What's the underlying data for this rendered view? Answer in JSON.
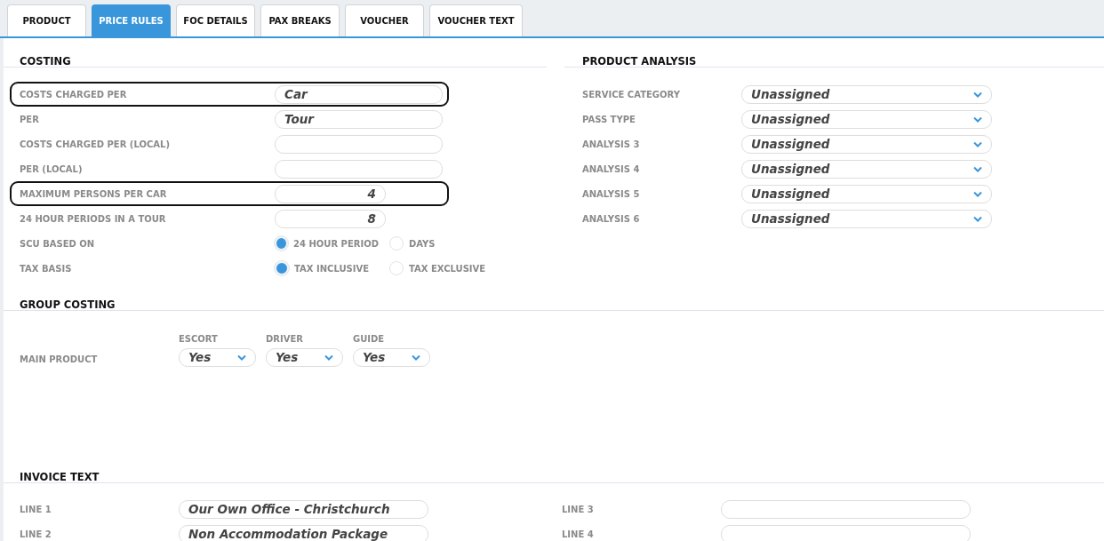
{
  "tabs": [
    {
      "label": "PRODUCT",
      "selected": false
    },
    {
      "label": "PRICE RULES",
      "selected": true
    },
    {
      "label": "FOC DETAILS",
      "selected": false
    },
    {
      "label": "PAX BREAKS",
      "selected": false
    },
    {
      "label": "VOUCHER",
      "selected": false
    },
    {
      "label": "VOUCHER TEXT",
      "selected": false
    }
  ],
  "costing": {
    "title": "COSTING",
    "rows": [
      {
        "label": "COSTS CHARGED PER",
        "kind": "text",
        "highlighted": true,
        "value": "Car"
      },
      {
        "label": "PER",
        "kind": "text",
        "highlighted": false,
        "value": "Tour"
      },
      {
        "label": "COSTS CHARGED PER (LOCAL)",
        "kind": "text",
        "highlighted": false
      },
      {
        "label": "PER (LOCAL)",
        "kind": "text",
        "highlighted": false
      },
      {
        "label": "MAXIMUM PERSONS PER CAR",
        "kind": "number",
        "highlighted": true,
        "value": "4"
      },
      {
        "label": "24 HOUR PERIODS IN A TOUR",
        "kind": "number",
        "highlighted": false,
        "value": "8"
      },
      {
        "label": "SCU BASED ON",
        "kind": "radio",
        "highlighted": false,
        "options": [
          {
            "label": "24 HOUR PERIOD",
            "selected": true
          },
          {
            "label": "DAYS",
            "selected": false
          }
        ]
      },
      {
        "label": "TAX BASIS",
        "kind": "radio",
        "highlighted": false,
        "options": [
          {
            "label": "TAX INCLUSIVE",
            "selected": true
          },
          {
            "label": "TAX EXCLUSIVE",
            "selected": false
          }
        ]
      }
    ]
  },
  "product_analysis": {
    "title": "PRODUCT ANALYSIS",
    "rows": [
      {
        "label": "SERVICE CATEGORY",
        "value": "Unassigned"
      },
      {
        "label": "PASS TYPE",
        "value": "Unassigned"
      },
      {
        "label": "ANALYSIS 3",
        "value": "Unassigned"
      },
      {
        "label": "ANALYSIS 4",
        "value": "Unassigned"
      },
      {
        "label": "ANALYSIS 5",
        "value": "Unassigned"
      },
      {
        "label": "ANALYSIS 6",
        "value": "Unassigned"
      }
    ]
  },
  "group_costing": {
    "title": "GROUP COSTING",
    "columns": [
      "ESCORT",
      "DRIVER",
      "GUIDE"
    ],
    "rows": [
      {
        "label": "MAIN PRODUCT",
        "values": [
          "Yes",
          "Yes",
          "Yes"
        ]
      }
    ]
  },
  "invoice_text": {
    "title": "INVOICE TEXT",
    "lines": [
      {
        "label": "LINE 1",
        "value": "Our Own Office - Christchurch"
      },
      {
        "label": "LINE 2",
        "value": "Non Accommodation Package"
      },
      {
        "label": "LINE 3"
      },
      {
        "label": "LINE 4"
      }
    ]
  }
}
